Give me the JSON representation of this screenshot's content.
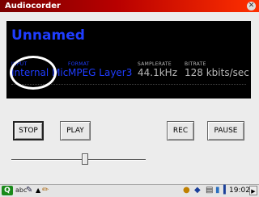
{
  "window": {
    "title": "Audiocorder",
    "close_glyph": "✕"
  },
  "display": {
    "name": "Unnamed",
    "input": {
      "label": "INPUT",
      "value": "Internal Mic"
    },
    "format": {
      "label": "FORMAT",
      "value": "MPEG Layer3"
    },
    "samplerate": {
      "label": "SAMPLERATE",
      "value": "44.1kHz"
    },
    "bitrate": {
      "label": "BITRATE",
      "value": "128 kbits/sec"
    }
  },
  "buttons": {
    "stop": "STOP",
    "play": "PLAY",
    "rec": "REC",
    "pause": "PAUSE"
  },
  "slider": {
    "position": 0.55
  },
  "taskbar": {
    "start_icon": "start-menu-icon",
    "clock": "19:02",
    "icons": [
      "keyboard-icon",
      "pen-icon",
      "up-arrow-icon",
      "pencil-icon",
      "lightbulb-icon",
      "network-icon",
      "clipboard-icon",
      "battery-icon",
      "volume-icon",
      "expand-arrow-icon"
    ]
  },
  "colors": {
    "accent_blue": "#1f3dff",
    "title_red": "#b80000",
    "display_bg": "#000000"
  }
}
